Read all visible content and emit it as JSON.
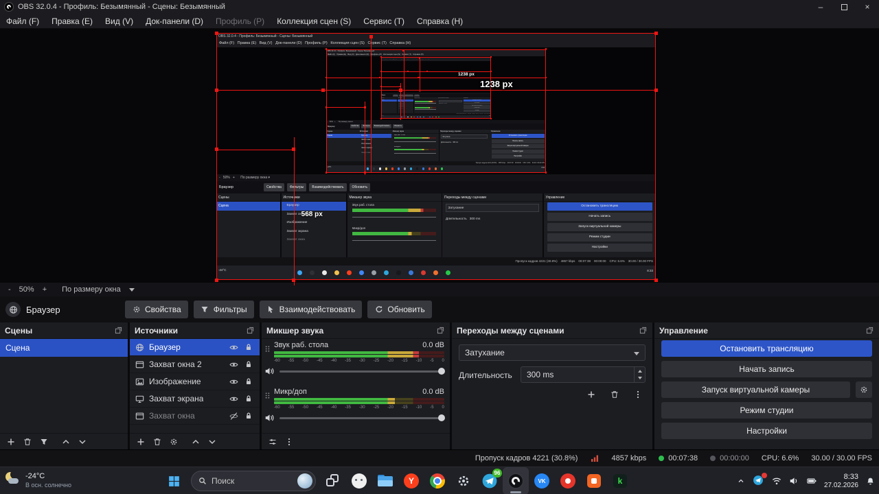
{
  "window": {
    "title": "OBS 32.0.4 - Профиль: Безымянный - Сцены: Безымянный"
  },
  "menu": {
    "items": [
      {
        "label": "Файл (F)"
      },
      {
        "label": "Правка (E)"
      },
      {
        "label": "Вид (V)"
      },
      {
        "label": "Док-панели (D)"
      },
      {
        "label": "Профиль (P)",
        "disabled": true
      },
      {
        "label": "Коллекция сцен (S)"
      },
      {
        "label": "Сервис (T)"
      },
      {
        "label": "Справка (H)"
      }
    ]
  },
  "preview": {
    "zoom": {
      "minus": "-",
      "level": "50%",
      "plus": "+",
      "fit": "По размеру окна"
    },
    "annotations": {
      "width_label": "1238 px",
      "height_label": "568 px"
    }
  },
  "source_toolbar": {
    "source_name": "Браузер",
    "buttons": [
      {
        "label": "Свойства",
        "icon": "gear"
      },
      {
        "label": "Фильтры",
        "icon": "filter"
      },
      {
        "label": "Взаимодействовать",
        "icon": "interact"
      },
      {
        "label": "Обновить",
        "icon": "refresh"
      }
    ]
  },
  "scenes": {
    "title": "Сцены",
    "items": [
      {
        "label": "Сцена",
        "selected": true
      }
    ]
  },
  "sources": {
    "title": "Источники",
    "items": [
      {
        "label": "Браузер",
        "icon": "globe",
        "selected": true,
        "visible": true,
        "locked": true
      },
      {
        "label": "Захват окна 2",
        "icon": "window",
        "visible": true,
        "locked": true
      },
      {
        "label": "Изображение",
        "icon": "image",
        "visible": true,
        "locked": true
      },
      {
        "label": "Захват экрана",
        "icon": "monitor",
        "visible": true,
        "locked": true
      },
      {
        "label": "Захват окна",
        "icon": "window",
        "visible": false,
        "locked": true,
        "dimmed": true
      }
    ]
  },
  "mixer": {
    "title": "Микшер звука",
    "tracks": [
      {
        "name": "Звук раб. стола",
        "db": "0.0 dB",
        "level": 0.85
      },
      {
        "name": "Микр/доп",
        "db": "0.0 dB",
        "level": 0.71
      }
    ],
    "scale_labels": [
      "-60",
      "-55",
      "-50",
      "-45",
      "-40",
      "-35",
      "-30",
      "-25",
      "-20",
      "-15",
      "-10",
      "-5",
      "0"
    ]
  },
  "transitions": {
    "title": "Переходы между сценами",
    "transition": "Затухание",
    "duration_label": "Длительность",
    "duration_value": "300 ms"
  },
  "controls": {
    "title": "Управление",
    "buttons": [
      "Остановить трансляцию",
      "Начать запись",
      "Запуск виртуальной камеры",
      "Режим студии",
      "Настройки"
    ]
  },
  "statusbar": {
    "dropped_frames": "Пропуск кадров 4221 (30.8%)",
    "bitrate": "4857 kbps",
    "stream_time": "00:07:38",
    "rec_time": "00:00:00",
    "cpu": "CPU: 6.6%",
    "fps": "30.00 / 30.00 FPS"
  },
  "taskbar": {
    "weather_temp": "-24°C",
    "weather_desc": "В осн. солнечно",
    "search_placeholder": "Поиск",
    "clock_time": "8:33",
    "clock_date": "27.02.2026",
    "apps": [
      {
        "name": "task-view"
      },
      {
        "name": "bear-photo"
      },
      {
        "name": "file-explorer"
      },
      {
        "name": "yandex-browser",
        "glyph": "Y"
      },
      {
        "name": "chrome"
      },
      {
        "name": "settings"
      },
      {
        "name": "telegram",
        "badge": "96"
      },
      {
        "name": "obs",
        "active": true
      },
      {
        "name": "vk",
        "glyph": "VK"
      },
      {
        "name": "red-media-app"
      },
      {
        "name": "orange-app"
      },
      {
        "name": "kino-app",
        "glyph": "k"
      }
    ]
  },
  "colors": {
    "accent": "#2d55c8",
    "selected_row": "#2b52c4",
    "annotation_red": "#ef1512",
    "meter_green": "#41b841",
    "meter_yellow": "#c9a93a",
    "meter_red": "#c43b3b",
    "streaming_green": "#2ebd4e"
  }
}
